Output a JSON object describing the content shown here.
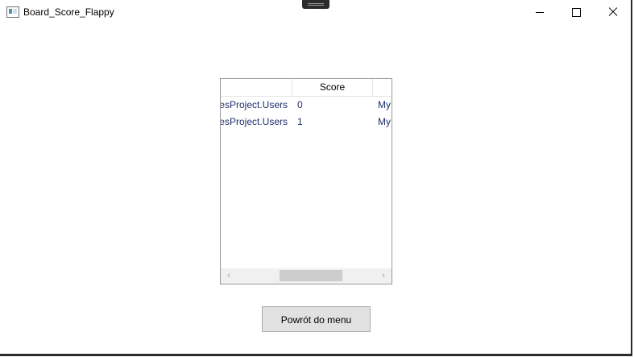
{
  "window": {
    "title": "Board_Score_Flappy"
  },
  "grid": {
    "columns": [
      "",
      "Score",
      ""
    ],
    "rows": [
      {
        "user": "GamesProject.Users",
        "score": "0",
        "extra": "My"
      },
      {
        "user": "GamesProject.Users",
        "score": "1",
        "extra": "My"
      }
    ],
    "scroll_left_glyph": "‹",
    "scroll_right_glyph": "›"
  },
  "actions": {
    "back_to_menu": "Powrót do menu"
  },
  "icons": {
    "app": "window-app-icon",
    "minimize": "minimize-icon",
    "maximize": "maximize-icon",
    "close": "close-icon"
  }
}
